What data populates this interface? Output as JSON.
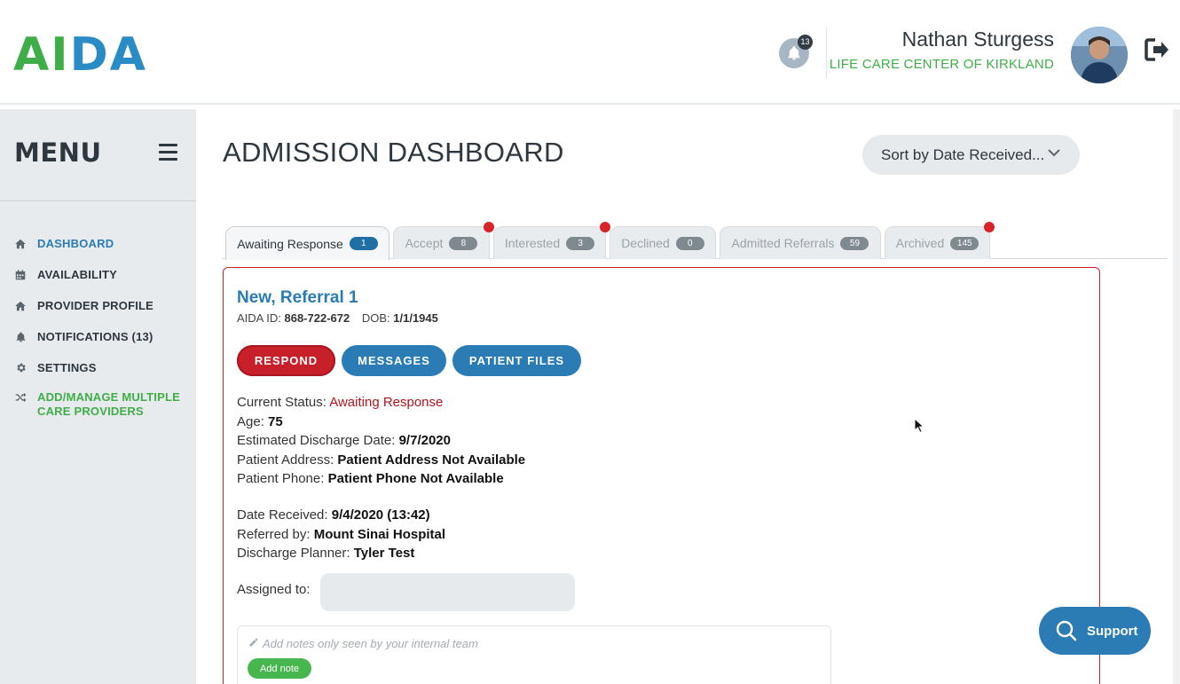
{
  "header": {
    "logo_part1": "AI",
    "logo_part2": "DA",
    "notification_count": "13",
    "user_name": "Nathan Sturgess",
    "organization": "LIFE CARE CENTER OF KIRKLAND",
    "icons": {
      "bell": "bell-icon",
      "logout": "logout-icon",
      "avatar": "user-avatar"
    }
  },
  "sidebar": {
    "title": "MENU",
    "items": [
      {
        "label": "DASHBOARD",
        "icon": "home-icon",
        "active": true
      },
      {
        "label": "AVAILABILITY",
        "icon": "calendar-icon"
      },
      {
        "label": "PROVIDER PROFILE",
        "icon": "home-icon"
      },
      {
        "label": "NOTIFICATIONS (13)",
        "icon": "bell-icon"
      },
      {
        "label": "SETTINGS",
        "icon": "gear-icon"
      },
      {
        "label": "ADD/MANAGE MULTIPLE CARE PROVIDERS",
        "icon": "shuffle-icon"
      }
    ]
  },
  "main": {
    "title": "ADMISSION DASHBOARD",
    "sort_label": "Sort by Date Received...",
    "tabs": [
      {
        "label": "Awaiting Response",
        "count": "1",
        "active": true,
        "dot": false
      },
      {
        "label": "Accept",
        "count": "8",
        "dot": true
      },
      {
        "label": "Interested",
        "count": "3",
        "dot": true
      },
      {
        "label": "Declined",
        "count": "0",
        "dot": false
      },
      {
        "label": "Admitted Referrals",
        "count": "59",
        "dot": false
      },
      {
        "label": "Archived",
        "count": "145",
        "dot": true
      }
    ],
    "referral": {
      "name": "New, Referral 1",
      "aida_id_label": "AIDA ID:",
      "aida_id": "868-722-672",
      "dob_label": "DOB:",
      "dob": "1/1/1945",
      "buttons": {
        "respond": "RESPOND",
        "messages": "MESSAGES",
        "patient_files": "PATIENT FILES"
      },
      "status_label": "Current Status:",
      "status": "Awaiting Response",
      "age_label": "Age:",
      "age": "75",
      "discharge_label": "Estimated Discharge Date:",
      "discharge_date": "9/7/2020",
      "address_label": "Patient Address:",
      "address": "Patient Address Not Available",
      "phone_label": "Patient Phone:",
      "phone": "Patient Phone Not Available",
      "received_label": "Date Received:",
      "received": "9/4/2020 (13:42)",
      "referred_label": "Referred by:",
      "referred_by": "Mount Sinai Hospital",
      "planner_label": "Discharge Planner:",
      "planner": "Tyler Test",
      "assigned_label": "Assigned to:",
      "notes_placeholder": "Add notes only seen by your internal team",
      "add_note": "Add note"
    }
  },
  "support_label": "Support",
  "colors": {
    "green": "#3fae49",
    "blue": "#2b7bb5",
    "red": "#c7202a"
  }
}
